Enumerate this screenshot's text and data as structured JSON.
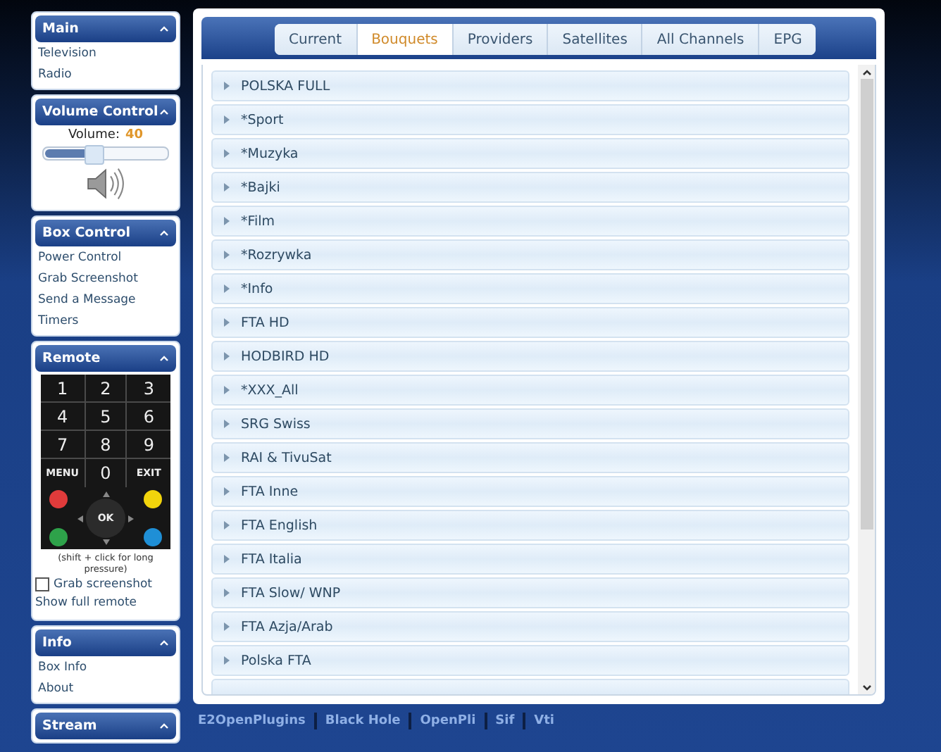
{
  "sidebar": [
    {
      "kind": "links",
      "title": "Main",
      "expanded": true,
      "items": [
        "Television",
        "Radio"
      ]
    },
    {
      "kind": "volume",
      "title": "Volume Control",
      "expanded": true,
      "volume_label": "Volume:",
      "volume_value": "40",
      "level": 0.4
    },
    {
      "kind": "links",
      "title": "Box Control",
      "expanded": true,
      "items": [
        "Power Control",
        "Grab Screenshot",
        "Send a Message",
        "Timers"
      ]
    },
    {
      "kind": "remote",
      "title": "Remote",
      "expanded": true,
      "keys": [
        "1",
        "2",
        "3",
        "4",
        "5",
        "6",
        "7",
        "8",
        "9",
        "MENU",
        "0",
        "EXIT"
      ],
      "ok": "OK",
      "color_buttons": [
        {
          "color": "#e03b3b"
        },
        {
          "color": "#f2d40c"
        },
        {
          "color": "#2ea24a"
        },
        {
          "color": "#1f8fd6"
        }
      ],
      "note": "(shift + click for long pressure)",
      "checkbox": {
        "label": "Grab screenshot",
        "checked": false
      },
      "link": "Show full remote"
    },
    {
      "kind": "links",
      "title": "Info",
      "expanded": true,
      "items": [
        "Box Info",
        "About"
      ]
    },
    {
      "kind": "links",
      "title": "Stream",
      "expanded": true
    }
  ],
  "tabs": [
    {
      "label": "Current",
      "selected": false
    },
    {
      "label": "Bouquets",
      "selected": true
    },
    {
      "label": "Providers",
      "selected": false
    },
    {
      "label": "Satellites",
      "selected": false
    },
    {
      "label": "All Channels",
      "selected": false
    },
    {
      "label": "EPG",
      "selected": false
    }
  ],
  "bouquets": [
    "POLSKA FULL",
    "*Sport",
    "*Muzyka",
    "*Bajki",
    "*Film",
    "*Rozrywka",
    "*Info",
    "FTA HD",
    "HODBIRD HD",
    "*XXX_All",
    "SRG Swiss",
    "RAI & TivuSat",
    "FTA Inne",
    "FTA English",
    "FTA Italia",
    "FTA Slow/ WNP",
    "FTA Azja/Arab",
    "Polska FTA"
  ],
  "footer_links": [
    "E2OpenPlugins",
    "Black Hole",
    "OpenPli",
    "Sif",
    "Vti"
  ]
}
